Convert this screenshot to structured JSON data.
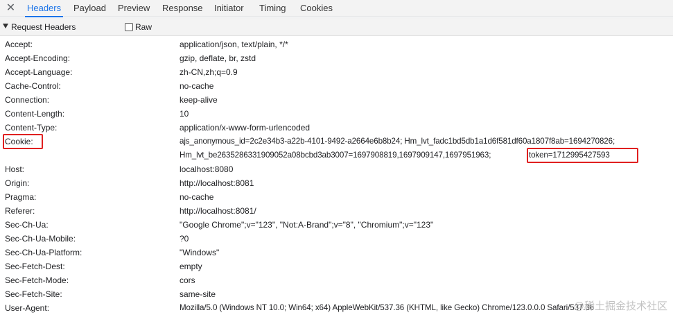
{
  "tabs": [
    {
      "label": "Headers",
      "active": true
    },
    {
      "label": "Payload",
      "active": false
    },
    {
      "label": "Preview",
      "active": false
    },
    {
      "label": "Response",
      "active": false
    },
    {
      "label": "Initiator",
      "active": false
    },
    {
      "label": "Timing",
      "active": false
    },
    {
      "label": "Cookies",
      "active": false
    }
  ],
  "section": {
    "title": "Request Headers",
    "raw_label": "Raw",
    "raw_checked": false
  },
  "headers": [
    {
      "name": "Accept:",
      "value": "application/json, text/plain, */*"
    },
    {
      "name": "Accept-Encoding:",
      "value": "gzip, deflate, br, zstd"
    },
    {
      "name": "Accept-Language:",
      "value": "zh-CN,zh;q=0.9"
    },
    {
      "name": "Cache-Control:",
      "value": "no-cache"
    },
    {
      "name": "Connection:",
      "value": "keep-alive"
    },
    {
      "name": "Content-Length:",
      "value": "10"
    },
    {
      "name": "Content-Type:",
      "value": "application/x-www-form-urlencoded"
    },
    {
      "name": "Cookie:",
      "value": "ajs_anonymous_id=2c2e34b3-a22b-4101-9492-a2664e6b8b24; Hm_lvt_fadc1bd5db1a1d6f581df60a1807f8ab=1694270826;",
      "value2a": "Hm_lvt_be2635286331909052a08bcbd3ab3007=1697908819,1697909147,1697951963;",
      "value2b": "token=1712995427593"
    },
    {
      "name": "Host:",
      "value": "localhost:8080"
    },
    {
      "name": "Origin:",
      "value": "http://localhost:8081"
    },
    {
      "name": "Pragma:",
      "value": "no-cache"
    },
    {
      "name": "Referer:",
      "value": "http://localhost:8081/"
    },
    {
      "name": "Sec-Ch-Ua:",
      "value": "\"Google Chrome\";v=\"123\", \"Not:A-Brand\";v=\"8\", \"Chromium\";v=\"123\""
    },
    {
      "name": "Sec-Ch-Ua-Mobile:",
      "value": "?0"
    },
    {
      "name": "Sec-Ch-Ua-Platform:",
      "value": "\"Windows\""
    },
    {
      "name": "Sec-Fetch-Dest:",
      "value": "empty"
    },
    {
      "name": "Sec-Fetch-Mode:",
      "value": "cors"
    },
    {
      "name": "Sec-Fetch-Site:",
      "value": "same-site"
    },
    {
      "name": "User-Agent:",
      "value": "Mozilla/5.0 (Windows NT 10.0; Win64; x64) AppleWebKit/537.36 (KHTML, like Gecko) Chrome/123.0.0.0 Safari/537.36"
    }
  ],
  "watermark": "@稀土掘金技术社区",
  "icons": {
    "close": "close-icon",
    "collapse": "triangle-down-icon"
  },
  "colors": {
    "accent": "#1a73e8",
    "highlight": "#e02020"
  }
}
